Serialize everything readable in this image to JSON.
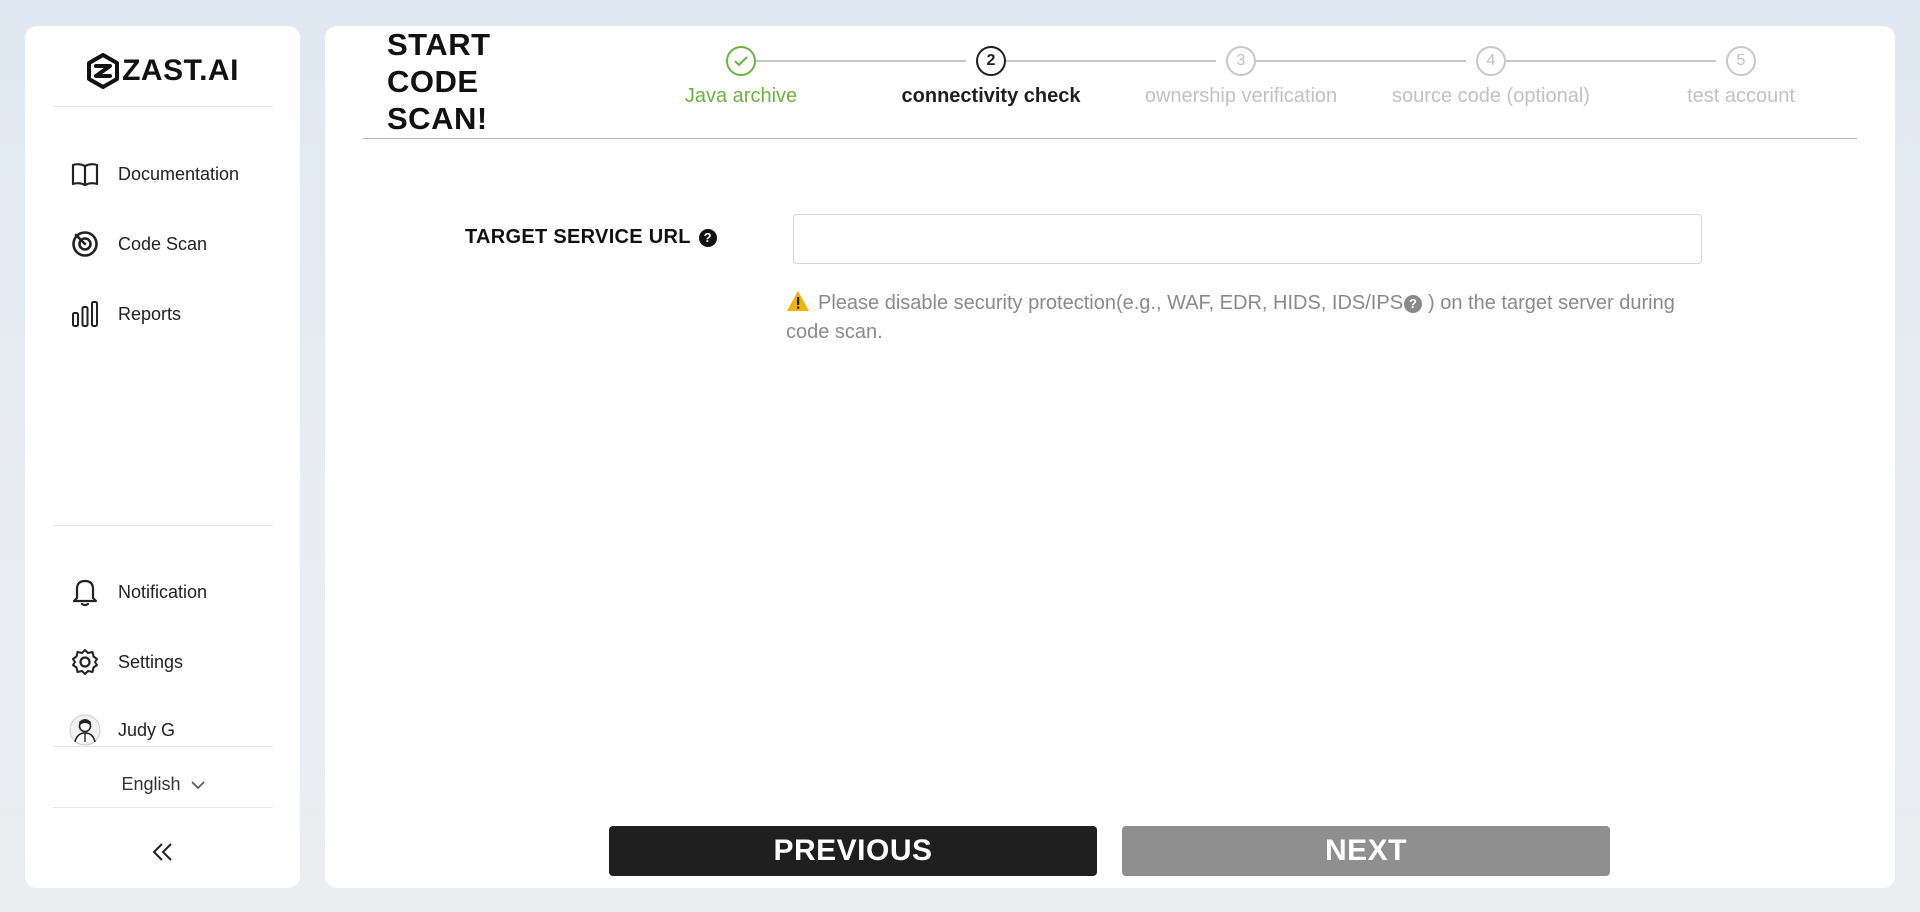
{
  "app": {
    "brand": "ZAST.AI"
  },
  "sidebar": {
    "nav_top": [
      {
        "label": "Documentation",
        "icon": "book-icon"
      },
      {
        "label": "Code Scan",
        "icon": "scan-target-icon"
      },
      {
        "label": "Reports",
        "icon": "bar-chart-icon"
      }
    ],
    "nav_bottom": [
      {
        "label": "Notification",
        "icon": "bell-icon"
      },
      {
        "label": "Settings",
        "icon": "gear-icon"
      },
      {
        "label": "Judy G",
        "icon": "avatar"
      }
    ],
    "language": "English",
    "collapse_icon": "double-chevron-left-icon"
  },
  "main": {
    "title": "START CODE SCAN!",
    "steps": [
      {
        "number": "1",
        "label": "Java archive",
        "state": "completed"
      },
      {
        "number": "2",
        "label": "connectivity check",
        "state": "active"
      },
      {
        "number": "3",
        "label": "ownership verification",
        "state": "pending"
      },
      {
        "number": "4",
        "label": "source code (optional)",
        "state": "pending"
      },
      {
        "number": "5",
        "label": "test account",
        "state": "pending"
      }
    ],
    "field": {
      "label": "TARGET SERVICE URL",
      "help": "?",
      "value": "",
      "placeholder": ""
    },
    "warning": {
      "text_before": "Please disable security protection(e.g., WAF, EDR, HIDS, IDS/IPS",
      "help": "?",
      "text_after": ") on the target server during code scan."
    },
    "buttons": {
      "previous": "PREVIOUS",
      "next": "NEXT"
    }
  },
  "colors": {
    "completed": "#6cb33f",
    "active": "#1f1f1f",
    "pending": "#c2c2c2",
    "warning": "#f2b200",
    "next_disabled": "#8f8f8f"
  }
}
